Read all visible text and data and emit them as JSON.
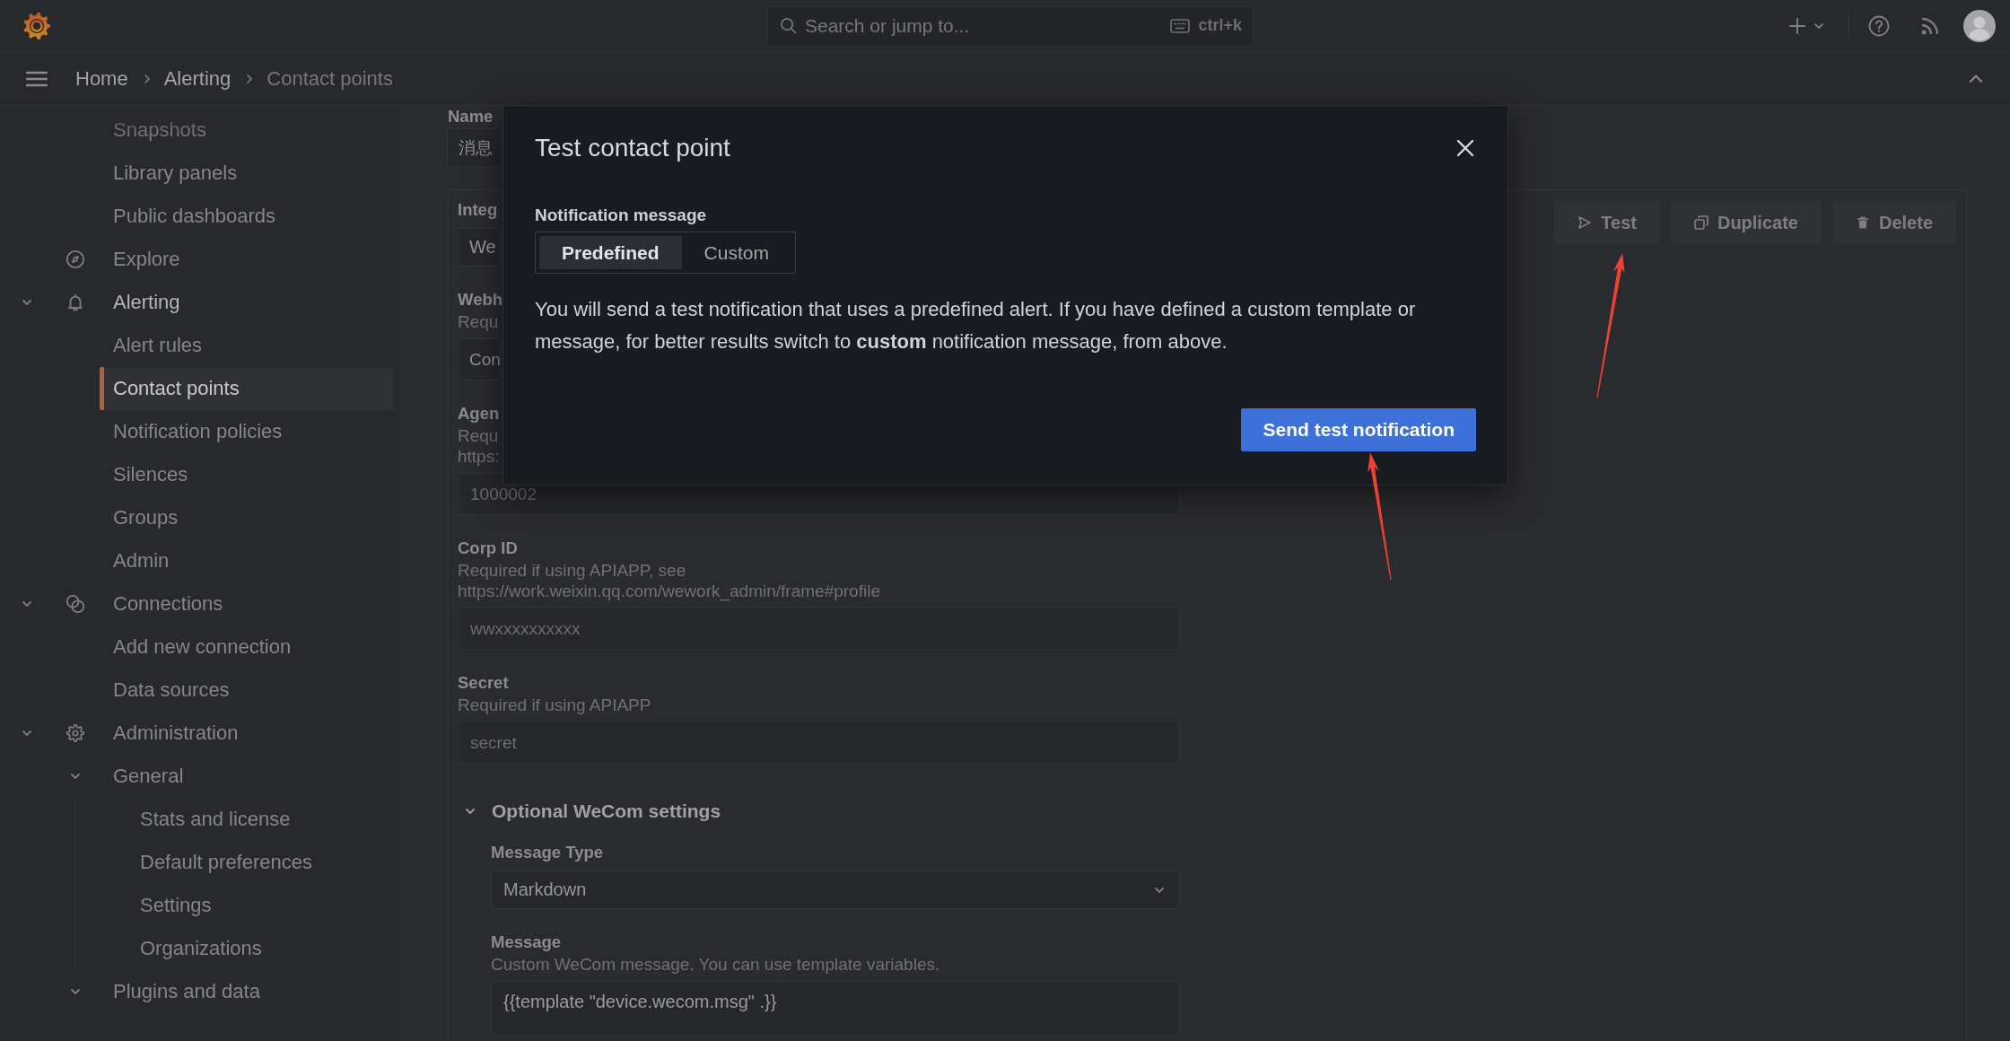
{
  "top_bar": {
    "search": {
      "placeholder": "Search or jump to...",
      "shortcut": "ctrl+k"
    }
  },
  "breadcrumbs": [
    {
      "label": "Home"
    },
    {
      "label": "Alerting"
    },
    {
      "label": "Contact points"
    }
  ],
  "sidebar": {
    "items": [
      {
        "kind": "link",
        "label": "Snapshots",
        "selected": false
      },
      {
        "kind": "link",
        "label": "Library panels",
        "selected": false
      },
      {
        "kind": "link",
        "label": "Public dashboards",
        "selected": false
      },
      {
        "kind": "section",
        "label": "Explore",
        "selected": false
      },
      {
        "kind": "section",
        "label": "Alerting",
        "selected": false,
        "expanded": true,
        "children": [
          {
            "label": "Alert rules",
            "selected": false
          },
          {
            "label": "Contact points",
            "selected": true
          },
          {
            "label": "Notification policies",
            "selected": false
          },
          {
            "label": "Silences",
            "selected": false
          },
          {
            "label": "Groups",
            "selected": false
          },
          {
            "label": "Admin",
            "selected": false
          }
        ]
      },
      {
        "kind": "section",
        "label": "Connections",
        "selected": false,
        "expanded": true,
        "children": [
          {
            "label": "Add new connection",
            "selected": false
          },
          {
            "label": "Data sources",
            "selected": false
          }
        ]
      },
      {
        "kind": "section",
        "label": "Administration",
        "selected": false,
        "expanded": true,
        "children": [
          {
            "label": "General",
            "selected": false,
            "expanded": true,
            "children": [
              {
                "label": "Stats and license",
                "selected": false
              },
              {
                "label": "Default preferences",
                "selected": false
              },
              {
                "label": "Settings",
                "selected": false
              },
              {
                "label": "Organizations",
                "selected": false
              }
            ]
          },
          {
            "label": "Plugins and data",
            "selected": false,
            "expanded": true
          }
        ]
      }
    ]
  },
  "form": {
    "name": {
      "label": "Name",
      "value": "消息"
    },
    "integration": {
      "fields": [
        {
          "kind": "select",
          "label": "Integ",
          "value": "We"
        },
        {
          "kind": "input",
          "label": "Webh",
          "description": "Requ",
          "value": "Con"
        },
        {
          "kind": "input",
          "label": "Agen",
          "description": "Requ https:",
          "placeholder": "1000002"
        },
        {
          "kind": "input",
          "label": "Corp ID",
          "description": "Required if using APIAPP, see https://work.weixin.qq.com/wework_admin/frame#profile",
          "placeholder": "wwxxxxxxxxxx"
        },
        {
          "kind": "input",
          "label": "Secret",
          "description": "Required if using APIAPP",
          "placeholder": "secret"
        }
      ],
      "actions": [
        {
          "label": "Test"
        },
        {
          "label": "Duplicate"
        },
        {
          "label": "Delete"
        }
      ],
      "optional_settings": {
        "title": "Optional WeCom settings",
        "expanded": true,
        "fields": [
          {
            "kind": "select",
            "label": "Message Type",
            "value": "Markdown"
          },
          {
            "kind": "textarea",
            "label": "Message",
            "description": "Custom WeCom message. You can use template variables.",
            "value": "{{template \"device.wecom.msg\" .}}"
          }
        ]
      }
    }
  },
  "modal": {
    "title": "Test contact point",
    "field_label": "Notification message",
    "options": [
      {
        "label": "Predefined",
        "selected": true
      },
      {
        "label": "Custom",
        "selected": false
      }
    ],
    "text": "You will send a test notification that uses a predefined alert. If you have defined a custom template or message, for better results switch to **custom** notification message, from above.",
    "primary_button": "Send test notification"
  }
}
